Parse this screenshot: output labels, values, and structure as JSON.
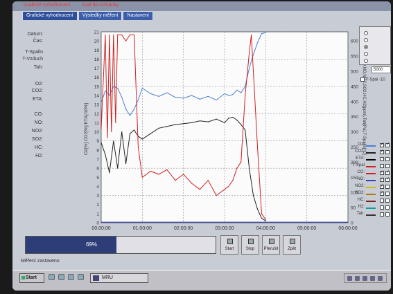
{
  "titlebar": {
    "title_left": "Grafické vyhodnocení",
    "title_right": "Graf do schránky"
  },
  "tabs": [
    {
      "label": "Grafické vyhodnocení"
    },
    {
      "label": "Výsledky měření"
    },
    {
      "label": "Nastavení"
    }
  ],
  "left_labels": [
    "Datum:",
    "Čas:",
    "T-Spalin",
    "T-Vzduch",
    "Tah:",
    "O2:",
    "CO2:",
    "ETA:",
    "CO:",
    "NO:",
    "NO2:",
    "SO2:",
    "HC:",
    "H2:"
  ],
  "left_axis_title": "O2[%]  CO2[%]  ETA[/10%]",
  "right_axis_title": "CO,NO,NO2,SO2,HC,H2[ppm],Tah[Pa],T-Spalin[°C]",
  "right_panel": {
    "radio_options": [
      {
        "label": "",
        "selected": false
      },
      {
        "label": "",
        "selected": false
      },
      {
        "label": "",
        "selected": true
      },
      {
        "label": "",
        "selected": false
      },
      {
        "label": "",
        "selected": false
      }
    ],
    "limit_value": "5000",
    "tspal_checkbox_label": "T-Spal -10"
  },
  "legend": [
    {
      "name": "O2:",
      "color": "#4a7fd6",
      "checked": true,
      "checked2": true
    },
    {
      "name": "CO2:",
      "color": "#222222",
      "checked": true,
      "checked2": false
    },
    {
      "name": "ETA:",
      "color": "#000000",
      "checked": false,
      "checked2": false
    },
    {
      "name": "T-Spal",
      "color": "#cc2222",
      "checked": false,
      "checked2": false
    },
    {
      "name": "CO:",
      "color": "#d11f1f",
      "checked": true,
      "checked2": true
    },
    {
      "name": "NO:",
      "color": "#2f3fb8",
      "checked": true,
      "checked2": true
    },
    {
      "name": "NO2:",
      "color": "#d6b800",
      "checked": true,
      "checked2": false
    },
    {
      "name": "SO2:",
      "color": "#b07a00",
      "checked": true,
      "checked2": false
    },
    {
      "name": "HC:",
      "color": "#7a1f1f",
      "checked": false,
      "checked2": false
    },
    {
      "name": "H2:",
      "color": "#00a0a0",
      "checked": false,
      "checked2": false
    },
    {
      "name": "Tah:",
      "color": "#333333",
      "checked": false,
      "checked2": false
    }
  ],
  "controls": {
    "progress_percent": 69,
    "progress_text": "69%",
    "buttons": [
      {
        "label": "Start",
        "icon": "play-icon"
      },
      {
        "label": "Stop",
        "icon": "stop-icon"
      },
      {
        "label": "Přerušit",
        "icon": "pause-icon"
      },
      {
        "label": "Zpět",
        "icon": "back-icon"
      }
    ]
  },
  "status_text": "Měření zastaveno",
  "taskbar": {
    "start_label": "Start",
    "task_label": "MRU"
  },
  "chart_data": {
    "type": "line",
    "x_ticks": [
      "00:00:00",
      "01:00:00",
      "02:00:00",
      "03:00:00",
      "04:00:00",
      "05:00:00",
      "06:00:00"
    ],
    "y_left_ticks": [
      0,
      1,
      2,
      3,
      4,
      5,
      6,
      7,
      8,
      9,
      10,
      11,
      12,
      13,
      14,
      15,
      16,
      17,
      18,
      19,
      20,
      21
    ],
    "y_right_ticks": [
      0,
      50,
      100,
      150,
      200,
      250,
      300,
      350,
      400,
      450,
      500,
      550,
      600
    ],
    "ylim_left": [
      0,
      21
    ],
    "ylim_right": [
      0,
      630
    ],
    "xlim_hours": [
      0,
      6
    ],
    "grid": true,
    "series": [
      {
        "name": "O2",
        "color": "#4a7fd6",
        "axis": "left",
        "x": [
          0.0,
          0.1,
          0.2,
          0.3,
          0.4,
          0.5,
          0.6,
          0.7,
          0.8,
          0.9,
          1.0,
          1.2,
          1.4,
          1.6,
          1.8,
          2.0,
          2.2,
          2.4,
          2.6,
          2.8,
          3.0,
          3.1,
          3.2,
          3.3,
          3.4,
          3.5,
          3.6,
          3.7,
          3.8,
          3.9,
          4.0
        ],
        "y": [
          13.2,
          14.5,
          14.0,
          15.0,
          14.8,
          13.8,
          12.5,
          11.8,
          12.5,
          13.5,
          14.8,
          14.2,
          13.9,
          14.3,
          13.8,
          13.7,
          14.0,
          13.6,
          13.9,
          13.5,
          14.2,
          14.0,
          14.1,
          14.6,
          14.3,
          15.0,
          17.0,
          18.5,
          19.8,
          20.8,
          20.9
        ]
      },
      {
        "name": "CO2",
        "color": "#222222",
        "axis": "left",
        "x": [
          0.0,
          0.1,
          0.2,
          0.3,
          0.4,
          0.5,
          0.6,
          0.7,
          0.8,
          0.9,
          1.0,
          1.2,
          1.4,
          1.6,
          1.8,
          2.0,
          2.2,
          2.4,
          2.6,
          2.8,
          3.0,
          3.1,
          3.2,
          3.3,
          3.4,
          3.5,
          3.6,
          3.7,
          3.8,
          3.9,
          4.0
        ],
        "y": [
          8.8,
          7.5,
          5.5,
          9.0,
          6.0,
          10.0,
          6.5,
          9.8,
          10.2,
          9.5,
          9.2,
          9.8,
          10.4,
          10.6,
          10.8,
          10.9,
          11.0,
          11.2,
          11.1,
          11.4,
          11.0,
          11.5,
          11.6,
          11.3,
          10.8,
          10.2,
          6.0,
          3.0,
          1.5,
          0.5,
          0.2
        ]
      },
      {
        "name": "CO",
        "color": "#d11f1f",
        "axis": "right",
        "x": [
          0.0,
          0.1,
          0.15,
          0.2,
          0.25,
          0.3,
          0.35,
          0.4,
          0.5,
          0.6,
          0.7,
          0.8,
          0.9,
          1.0,
          1.2,
          1.4,
          1.6,
          1.8,
          2.0,
          2.2,
          2.4,
          2.6,
          2.8,
          3.0,
          3.1,
          3.2,
          3.3,
          3.4,
          3.5,
          3.6,
          3.65,
          3.7,
          3.8,
          3.9,
          4.0
        ],
        "y": [
          310,
          620,
          280,
          620,
          300,
          620,
          330,
          620,
          620,
          600,
          620,
          620,
          250,
          150,
          170,
          160,
          175,
          140,
          160,
          130,
          110,
          140,
          90,
          110,
          120,
          140,
          180,
          200,
          420,
          560,
          620,
          500,
          250,
          30,
          10
        ]
      },
      {
        "name": "NO",
        "color": "#2f3fb8",
        "axis": "right",
        "x": [
          0.0,
          1.0,
          2.0,
          3.0,
          4.0,
          5.0,
          6.0
        ],
        "y": [
          2,
          2,
          2,
          2,
          2,
          2,
          2
        ]
      }
    ]
  }
}
